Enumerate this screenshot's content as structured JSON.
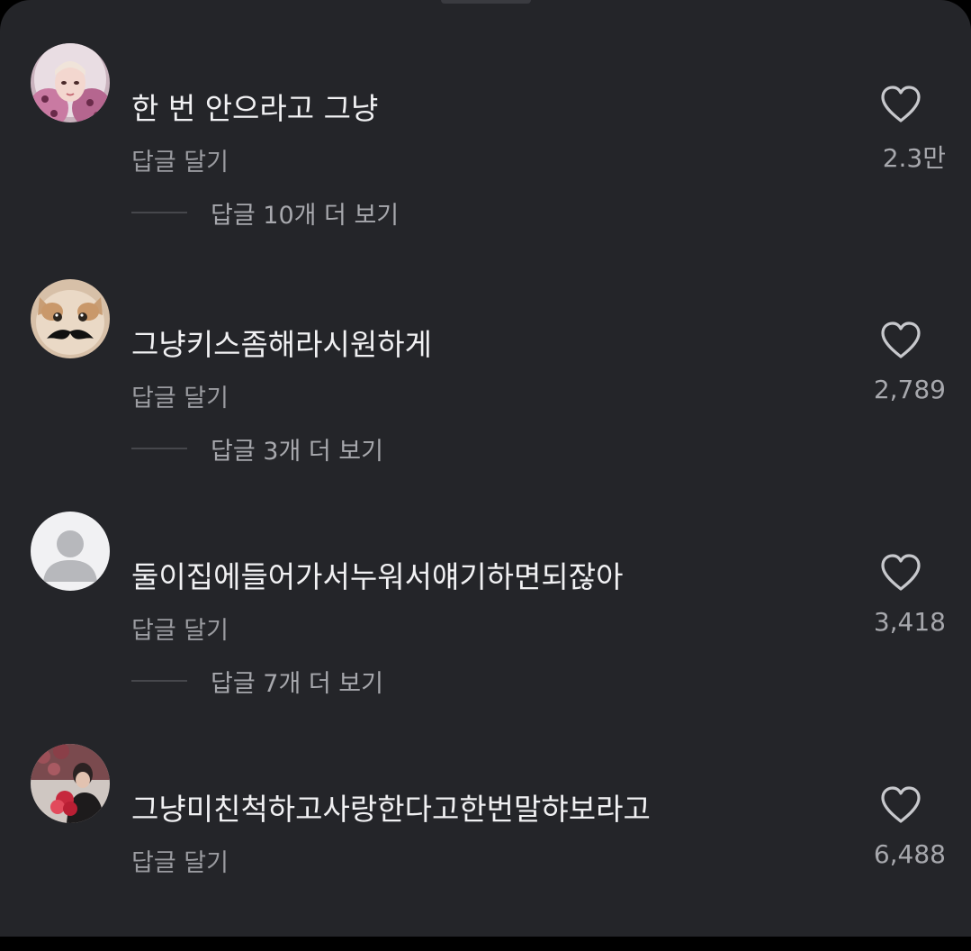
{
  "colors": {
    "background": "#242529",
    "primary_text": "#f1f1f3",
    "secondary_text": "#9a9ba0"
  },
  "comments": [
    {
      "avatar": "avatar-photo-pink-hooded-person",
      "text": "한 번 안으라고 그냥",
      "reply_label": "답글 달기",
      "view_replies": "답글 10개 더 보기",
      "likes": "2.3만",
      "like_icon": "heart-outline-icon"
    },
    {
      "avatar": "avatar-photo-cat-with-mustache",
      "text": "그냥키스좀해라시원하게",
      "reply_label": "답글 달기",
      "view_replies": "답글 3개 더 보기",
      "likes": "2,789",
      "like_icon": "heart-outline-icon"
    },
    {
      "avatar": "avatar-default-person-icon",
      "text": "둘이집에들어가서누워서얘기하면되잖아",
      "reply_label": "답글 달기",
      "view_replies": "답글 7개 더 보기",
      "likes": "3,418",
      "like_icon": "heart-outline-icon"
    },
    {
      "avatar": "avatar-photo-person-with-flowers",
      "text": "그냥미친척하고사랑한다고한번말햐보라고",
      "reply_label": "답글 달기",
      "view_replies": "",
      "likes": "6,488",
      "like_icon": "heart-outline-icon"
    }
  ]
}
